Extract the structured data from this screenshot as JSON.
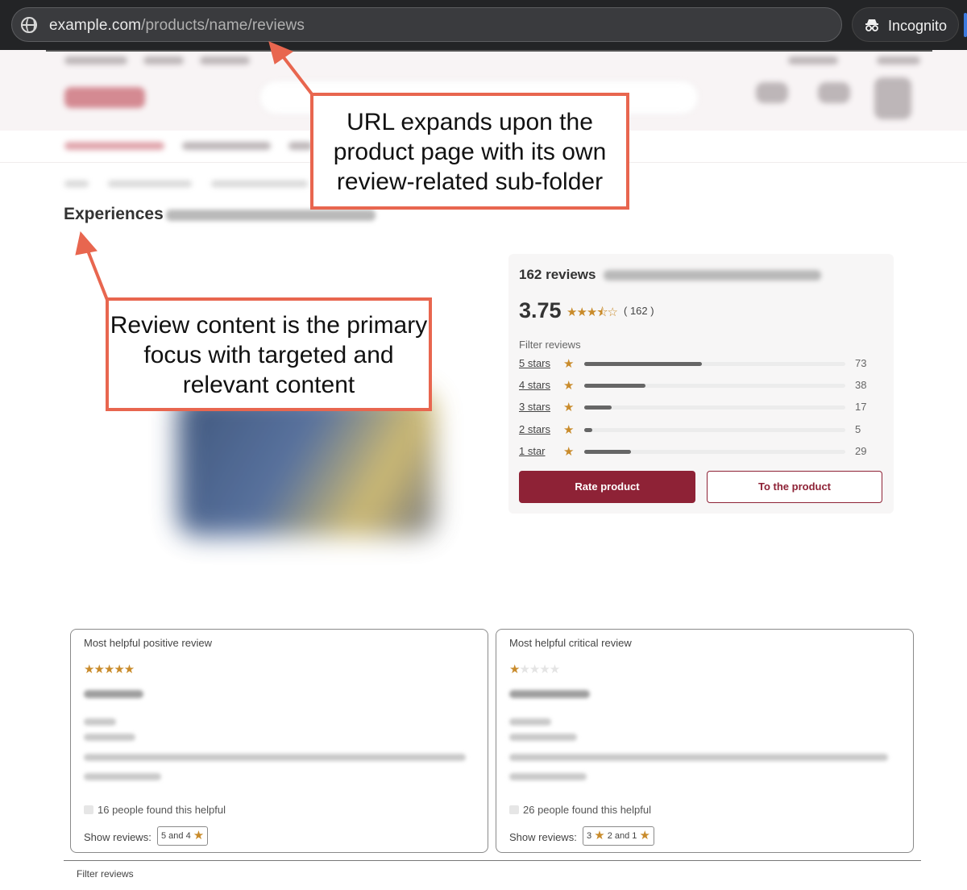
{
  "browser": {
    "url_host": "example.com",
    "url_path": "/products/name/reviews",
    "incognito_label": "Incognito"
  },
  "page": {
    "title": "Experiences"
  },
  "summary": {
    "heading": "162 reviews",
    "average": "3.75",
    "stars_display": "★★★⯪☆",
    "count": "( 162 )",
    "filter_label": "Filter reviews",
    "rows": [
      {
        "label": "5 stars",
        "count": "73",
        "share": 0.45
      },
      {
        "label": "4 stars",
        "count": "38",
        "share": 0.235
      },
      {
        "label": "3 stars",
        "count": "17",
        "share": 0.105
      },
      {
        "label": "2 stars",
        "count": "5",
        "share": 0.031
      },
      {
        "label": "1 star",
        "count": "29",
        "share": 0.179
      }
    ],
    "rate_button": "Rate product",
    "product_button": "To the product"
  },
  "annotations": {
    "url_note": "URL expands upon the product page with its own review-related sub-folder",
    "content_note": "Review content is the primary focus with targeted and relevant content",
    "color": "#e8664f"
  },
  "positive_review": {
    "title": "Most helpful positive review",
    "stars": "★★★★★",
    "helpful": "16 people found this helpful",
    "show_label": "Show reviews:",
    "chip_text": "5 and 4"
  },
  "critical_review": {
    "title": "Most helpful critical review",
    "star_on": "★",
    "stars_off": "★★★★",
    "helpful": "26 people found this helpful",
    "show_label": "Show reviews:",
    "chip_a": "3",
    "chip_b": "2 and 1"
  },
  "footer": {
    "filter_label": "Filter reviews"
  },
  "colors": {
    "brand": "#8e2236",
    "star": "#c98b2b"
  }
}
